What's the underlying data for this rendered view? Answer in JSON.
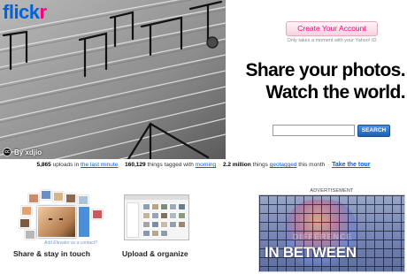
{
  "logo": {
    "main": "flick",
    "accent": "r"
  },
  "hero": {
    "credit": "By xdjio",
    "cc_mark": "cc"
  },
  "signup": {
    "button_label": "Create Your Account",
    "subtext": "Only takes a moment with your Yahoo! ID"
  },
  "tagline": {
    "line1": "Share your photos.",
    "line2": "Watch the world."
  },
  "search": {
    "placeholder": "",
    "button_label": "SEARCH"
  },
  "stats": {
    "uploads_count": "5,865",
    "uploads_text": "uploads in",
    "uploads_link": "the last minute",
    "tagged_count": "160,129",
    "tagged_text": "things tagged with",
    "tagged_link": "morning",
    "geotagged_count": "2.2 million",
    "geotagged_pre": "things",
    "geotagged_link": "geotagged",
    "geotagged_post": "this month",
    "tour_link": "Take the tour"
  },
  "features": {
    "share_label": "Share & stay in touch",
    "contact_text": "Add Elevator as a contact?",
    "upload_label": "Upload & organize"
  },
  "ad": {
    "label": "ADVERTISEMENT",
    "headline_small": "DIFFERENCE",
    "headline": "IN BETWEEN"
  },
  "colors": {
    "flickr_blue": "#0063dc",
    "flickr_pink": "#ff0084",
    "search_blue": "#1e5fb3"
  }
}
